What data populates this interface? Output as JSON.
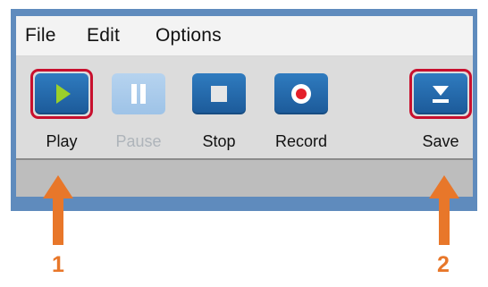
{
  "menu": {
    "items": [
      "File",
      "Edit",
      "Options"
    ]
  },
  "toolbar": {
    "play": {
      "label": "Play",
      "icon": "play-icon",
      "enabled": true
    },
    "pause": {
      "label": "Pause",
      "icon": "pause-icon",
      "enabled": false
    },
    "stop": {
      "label": "Stop",
      "icon": "stop-icon",
      "enabled": true
    },
    "record": {
      "label": "Record",
      "icon": "record-icon",
      "enabled": true
    },
    "save": {
      "label": "Save",
      "icon": "save-icon",
      "enabled": true
    }
  },
  "annotations": {
    "callout_1": "1",
    "callout_2": "2"
  },
  "colors": {
    "frame": "#5f8bbd",
    "button": "#2f7bbf",
    "highlight": "#c8102e",
    "arrow": "#e8772a",
    "play_triangle": "#9bd02a",
    "record_dot": "#e41f2a"
  }
}
